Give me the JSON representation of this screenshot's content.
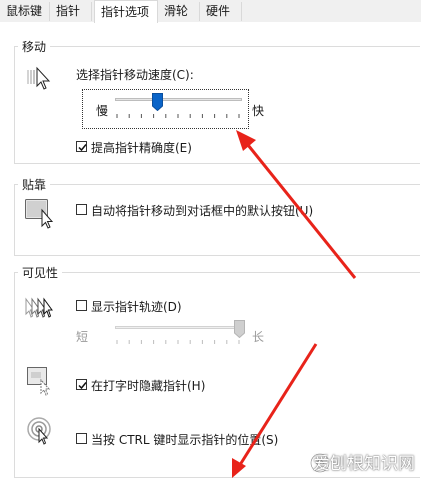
{
  "tabs": [
    {
      "label": "鼠标键"
    },
    {
      "label": "指针"
    },
    {
      "label": "指针选项",
      "active": true
    },
    {
      "label": "滑轮"
    },
    {
      "label": "硬件"
    }
  ],
  "motion": {
    "title": "移动",
    "speed_label": "选择指针移动速度(C):",
    "slow_label": "慢",
    "fast_label": "快",
    "speed_level": 0.33,
    "precision_label": "提高指针精确度(E)",
    "precision_checked": true
  },
  "snap": {
    "title": "贴靠",
    "snap_label": "自动将指针移动到对话框中的默认按钮(U)",
    "snap_checked": false
  },
  "visibility": {
    "title": "可见性",
    "trails_label": "显示指针轨迹(D)",
    "trails_checked": false,
    "short_label": "短",
    "long_label": "长",
    "trails_level": 1.0,
    "hide_label": "在打字时隐藏指针(H)",
    "hide_checked": true,
    "ctrl_label": "当按 CTRL 键时显示指针的位置(S)",
    "ctrl_checked": false
  },
  "watermark": {
    "text": "爱刨根知识网"
  },
  "colors": {
    "arrow": "#e8231a",
    "thumb": "#0a64c8"
  }
}
